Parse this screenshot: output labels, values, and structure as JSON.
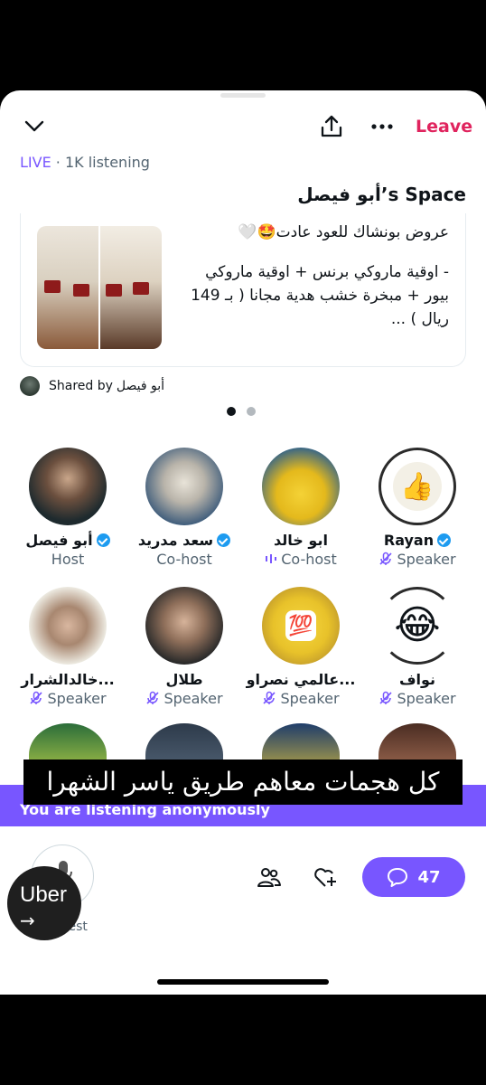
{
  "header": {
    "leave_label": "Leave",
    "live_label": "LIVE",
    "listening": " · 1K listening",
    "space_title": "أبو فيصل’s Space"
  },
  "card": {
    "line1": "عروض بونشاك للعود عادت🤩🤍",
    "line2": "- اوقية ماروكي برنس + اوقية ماروكي بيور + مبخرة خشب هدية مجانا ( بـ 149 ريال ) ..."
  },
  "shared": {
    "label": "Shared by",
    "name": "أبو فيصل"
  },
  "carousel": {
    "pages": 2,
    "active": 1
  },
  "participants": [
    {
      "name": "أبو فيصل",
      "role": "Host",
      "verified": true,
      "icon": "avatar-photo"
    },
    {
      "name": "سعد مدريد",
      "role": "Co-host",
      "verified": true,
      "icon": "avatar-photo"
    },
    {
      "name": "ابو خالد",
      "role": "Co-host",
      "verified": false,
      "icon": "speaking-indicator"
    },
    {
      "name": "Rayan",
      "role": "Speaker",
      "verified": true,
      "icon": "mic-off-icon",
      "emoji": "👍"
    },
    {
      "name": "خالدالشرار...",
      "role": "Speaker",
      "verified": false,
      "icon": "mic-off-icon"
    },
    {
      "name": "طلال",
      "role": "Speaker",
      "verified": false,
      "icon": "mic-off-icon"
    },
    {
      "name": "عالمي نصراو...",
      "role": "Speaker",
      "verified": false,
      "icon": "mic-off-icon",
      "emoji": "💯"
    },
    {
      "name": "نواف",
      "role": "Speaker",
      "verified": false,
      "icon": "mic-off-icon",
      "emoji": "😂"
    }
  ],
  "banner": {
    "text": "You are listening anonymously"
  },
  "subtitle": {
    "text": "كل هجمات معاهم طريق ياسر الشهرا"
  },
  "bottom": {
    "request_label": "Request",
    "comments_count": "47"
  },
  "overlay": {
    "uber_label": "Uber",
    "uber_arrow": "→"
  },
  "colors": {
    "accent": "#7856ff",
    "leave": "#e0245e",
    "verified": "#1d9bf0"
  }
}
